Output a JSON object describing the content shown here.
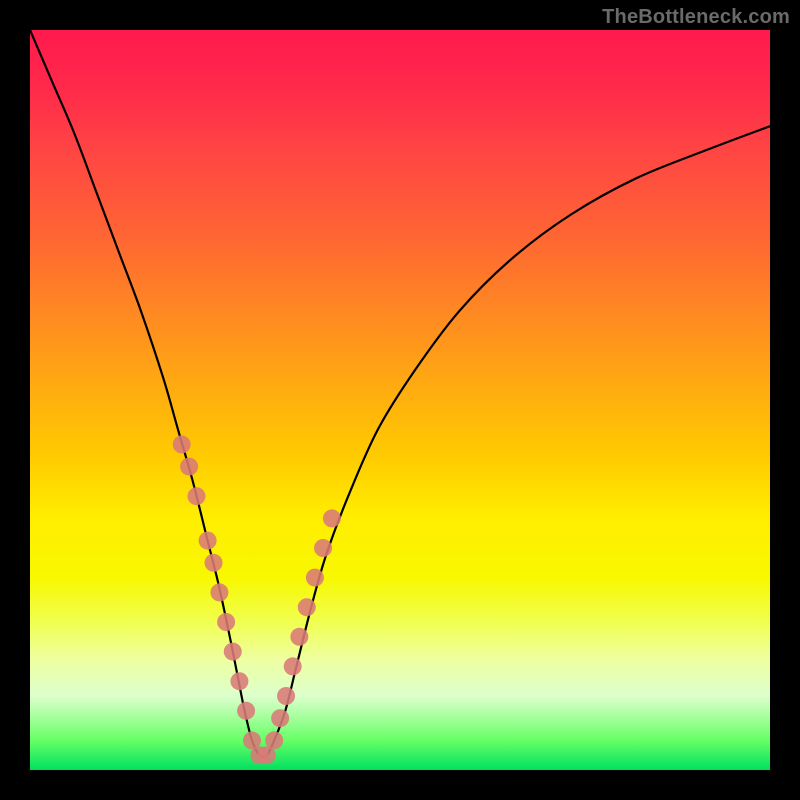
{
  "watermark": "TheBottleneck.com",
  "chart_data": {
    "type": "line",
    "title": "",
    "xlabel": "",
    "ylabel": "",
    "xlim": [
      0,
      100
    ],
    "ylim": [
      0,
      100
    ],
    "series": [
      {
        "name": "bottleneck-curve",
        "x": [
          0,
          3,
          6,
          9,
          12,
          15,
          18,
          20,
          22,
          24,
          25.5,
          27,
          28,
          29,
          30,
          31,
          32,
          33,
          34.5,
          36,
          38,
          40,
          43,
          47,
          52,
          58,
          65,
          73,
          82,
          92,
          100
        ],
        "y": [
          100,
          93,
          86,
          78,
          70,
          62,
          53,
          46,
          39,
          31,
          25,
          18,
          13,
          8,
          4,
          2,
          2,
          4,
          8,
          14,
          22,
          29,
          37,
          46,
          54,
          62,
          69,
          75,
          80,
          84,
          87
        ]
      }
    ],
    "markers": {
      "name": "sample-points",
      "color": "#d97a78",
      "radius_px": 9,
      "x": [
        20.5,
        21.5,
        22.5,
        24.0,
        24.8,
        25.6,
        26.5,
        27.4,
        28.3,
        29.2,
        30.0,
        31.0,
        32.0,
        33.0,
        33.8,
        34.6,
        35.5,
        36.4,
        37.4,
        38.5,
        39.6,
        40.8
      ],
      "y": [
        44,
        41,
        37,
        31,
        28,
        24,
        20,
        16,
        12,
        8,
        4,
        2,
        2,
        4,
        7,
        10,
        14,
        18,
        22,
        26,
        30,
        34
      ]
    },
    "background_gradient": {
      "top": "#ff1a4d",
      "mid": "#ffcc00",
      "bottom": "#00e060"
    }
  }
}
